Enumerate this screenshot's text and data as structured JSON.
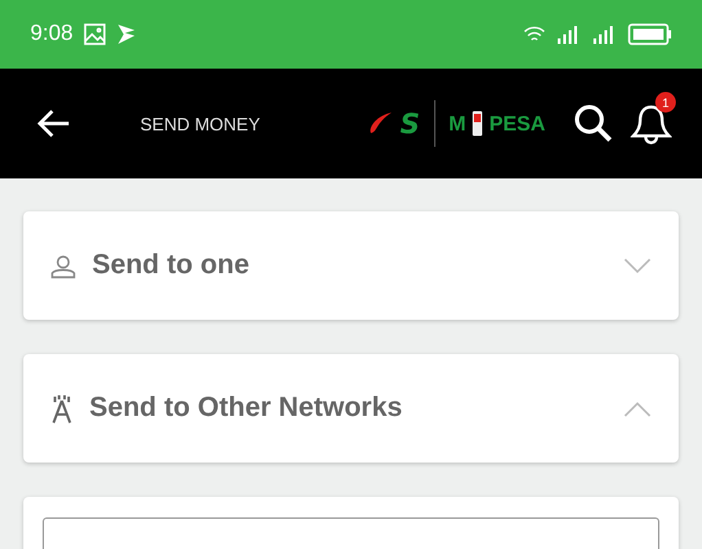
{
  "status_bar": {
    "time": "9:08"
  },
  "header": {
    "title": "SEND MONEY",
    "logo": {
      "left": "S",
      "right_start": "M",
      "right_end": "PESA"
    },
    "notification_count": "1"
  },
  "sections": [
    {
      "kind": "person",
      "label": "Send to one",
      "expanded": false
    },
    {
      "kind": "tower",
      "label": "Send to Other Networks",
      "expanded": true
    }
  ]
}
